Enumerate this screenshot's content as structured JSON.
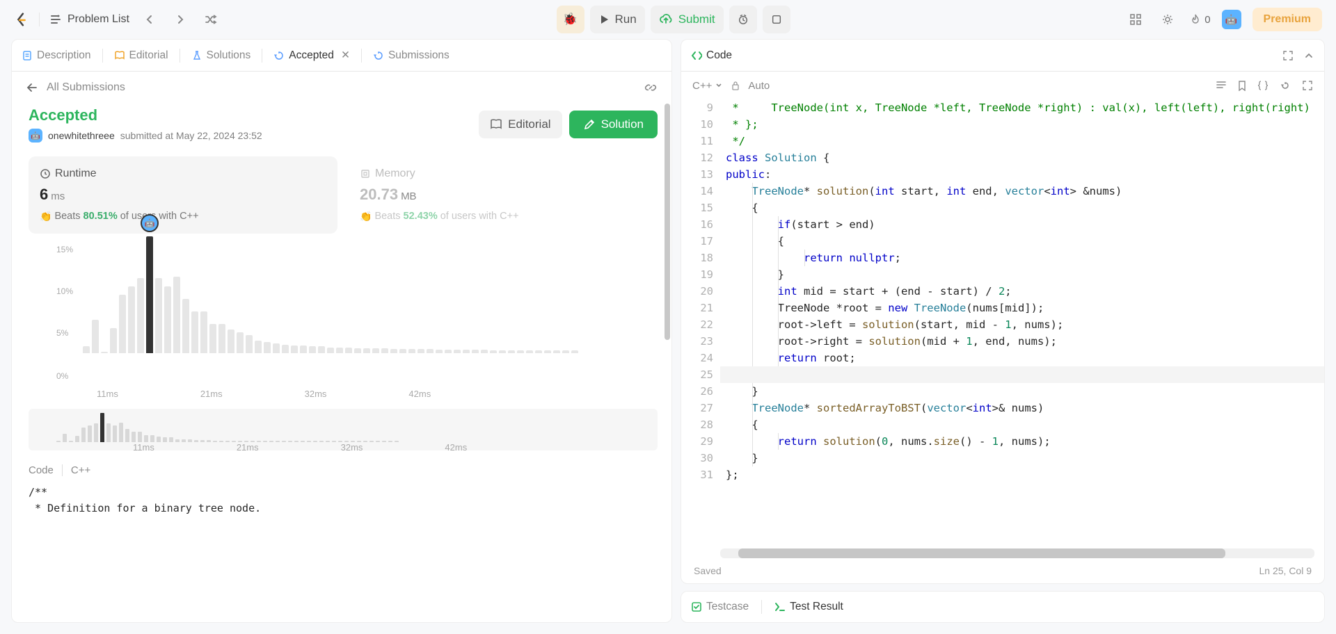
{
  "topbar": {
    "problem_list": "Problem List",
    "run": "Run",
    "submit": "Submit",
    "flame_count": "0",
    "premium": "Premium"
  },
  "tabs": {
    "description": "Description",
    "editorial": "Editorial",
    "solutions": "Solutions",
    "accepted": "Accepted",
    "submissions": "Submissions",
    "code": "Code"
  },
  "subheader": {
    "all_submissions": "All Submissions"
  },
  "result": {
    "status": "Accepted",
    "username": "onewhitethreee",
    "submitted_at": "submitted at May 22, 2024 23:52",
    "btn_editorial": "Editorial",
    "btn_solution": "Solution"
  },
  "stats": {
    "runtime": {
      "label": "Runtime",
      "value": "6",
      "unit": "ms",
      "beats_label": "Beats",
      "beats_pct": "80.51%",
      "beats_rest": "of users with C++"
    },
    "memory": {
      "label": "Memory",
      "value": "20.73",
      "unit": "MB",
      "beats_label": "Beats",
      "beats_pct": "52.43%",
      "beats_rest": "of users with C++"
    }
  },
  "chart_data": {
    "type": "bar",
    "ylabel": "percent",
    "yticks": [
      "15%",
      "10%",
      "5%",
      "0%"
    ],
    "xticks": [
      "11ms",
      "21ms",
      "32ms",
      "42ms"
    ],
    "bars_pct": [
      0.8,
      4,
      0.2,
      3,
      7,
      8,
      9,
      14,
      9,
      8,
      9.2,
      6.5,
      5,
      5,
      3.5,
      3.5,
      2.8,
      2.5,
      2.2,
      1.5,
      1.3,
      1.2,
      1.0,
      0.9,
      0.9,
      0.8,
      0.8,
      0.7,
      0.7,
      0.7,
      0.6,
      0.6,
      0.6,
      0.6,
      0.5,
      0.5,
      0.5,
      0.5,
      0.5,
      0.4,
      0.4,
      0.4,
      0.4,
      0.4,
      0.4,
      0.3,
      0.3,
      0.3,
      0.3,
      0.3,
      0.3,
      0.3,
      0.3,
      0.3,
      0.3
    ],
    "highlight_index": 7,
    "mini_xticks": [
      "11ms",
      "21ms",
      "32ms",
      "42ms"
    ]
  },
  "code_section": {
    "label": "Code",
    "lang": "C++",
    "snippet_lines": [
      "/**",
      " * Definition for a binary tree node."
    ]
  },
  "editor": {
    "lang": "C++",
    "auto": "Auto",
    "saved": "Saved",
    "cursor": "Ln 25, Col 9",
    "start_line": 9,
    "lines": [
      [
        {
          "t": " *     ",
          "c": "com"
        },
        {
          "t": "TreeNode(int x, TreeNode *left, TreeNode *right) : val(x), left(left), right(right)",
          "c": "com"
        }
      ],
      [
        {
          "t": " * };",
          "c": "com"
        }
      ],
      [
        {
          "t": " */",
          "c": "com"
        }
      ],
      [
        {
          "t": "class ",
          "c": "kw"
        },
        {
          "t": "Solution",
          "c": "cls"
        },
        {
          "t": " {",
          "c": ""
        }
      ],
      [
        {
          "t": "public",
          "c": "kw"
        },
        {
          "t": ":",
          "c": ""
        }
      ],
      [
        {
          "t": "    ",
          "c": ""
        },
        {
          "t": "TreeNode",
          "c": "type2"
        },
        {
          "t": "* ",
          "c": ""
        },
        {
          "t": "solution",
          "c": "fn"
        },
        {
          "t": "(",
          "c": ""
        },
        {
          "t": "int",
          "c": "kw"
        },
        {
          "t": " start, ",
          "c": ""
        },
        {
          "t": "int",
          "c": "kw"
        },
        {
          "t": " end, ",
          "c": ""
        },
        {
          "t": "vector",
          "c": "type2"
        },
        {
          "t": "<",
          "c": ""
        },
        {
          "t": "int",
          "c": "kw"
        },
        {
          "t": "> &nums)",
          "c": ""
        }
      ],
      [
        {
          "t": "    {",
          "c": ""
        }
      ],
      [
        {
          "t": "        ",
          "c": ""
        },
        {
          "t": "if",
          "c": "kw"
        },
        {
          "t": "(start > end)",
          "c": ""
        }
      ],
      [
        {
          "t": "        {",
          "c": ""
        }
      ],
      [
        {
          "t": "            ",
          "c": ""
        },
        {
          "t": "return",
          "c": "kw"
        },
        {
          "t": " ",
          "c": ""
        },
        {
          "t": "nullptr",
          "c": "kw"
        },
        {
          "t": ";",
          "c": ""
        }
      ],
      [
        {
          "t": "        }",
          "c": ""
        }
      ],
      [
        {
          "t": "        ",
          "c": ""
        },
        {
          "t": "int",
          "c": "kw"
        },
        {
          "t": " mid = start + (end - start) / ",
          "c": ""
        },
        {
          "t": "2",
          "c": "num"
        },
        {
          "t": ";",
          "c": ""
        }
      ],
      [
        {
          "t": "        TreeNode *root = ",
          "c": ""
        },
        {
          "t": "new",
          "c": "kw"
        },
        {
          "t": " ",
          "c": ""
        },
        {
          "t": "TreeNode",
          "c": "type2"
        },
        {
          "t": "(nums[mid]);",
          "c": ""
        }
      ],
      [
        {
          "t": "        root->left = ",
          "c": ""
        },
        {
          "t": "solution",
          "c": "fn"
        },
        {
          "t": "(start, mid - ",
          "c": ""
        },
        {
          "t": "1",
          "c": "num"
        },
        {
          "t": ", nums);",
          "c": ""
        }
      ],
      [
        {
          "t": "        root->right = ",
          "c": ""
        },
        {
          "t": "solution",
          "c": "fn"
        },
        {
          "t": "(mid + ",
          "c": ""
        },
        {
          "t": "1",
          "c": "num"
        },
        {
          "t": ", end, nums);",
          "c": ""
        }
      ],
      [
        {
          "t": "        ",
          "c": ""
        },
        {
          "t": "return",
          "c": "kw"
        },
        {
          "t": " root;",
          "c": ""
        }
      ],
      [
        {
          "t": "",
          "c": ""
        }
      ],
      [
        {
          "t": "    }",
          "c": ""
        }
      ],
      [
        {
          "t": "    ",
          "c": ""
        },
        {
          "t": "TreeNode",
          "c": "type2"
        },
        {
          "t": "* ",
          "c": ""
        },
        {
          "t": "sortedArrayToBST",
          "c": "fn"
        },
        {
          "t": "(",
          "c": ""
        },
        {
          "t": "vector",
          "c": "type2"
        },
        {
          "t": "<",
          "c": ""
        },
        {
          "t": "int",
          "c": "kw"
        },
        {
          "t": ">& nums)",
          "c": ""
        }
      ],
      [
        {
          "t": "    {",
          "c": ""
        }
      ],
      [
        {
          "t": "        ",
          "c": ""
        },
        {
          "t": "return",
          "c": "kw"
        },
        {
          "t": " ",
          "c": ""
        },
        {
          "t": "solution",
          "c": "fn"
        },
        {
          "t": "(",
          "c": ""
        },
        {
          "t": "0",
          "c": "num"
        },
        {
          "t": ", nums.",
          "c": ""
        },
        {
          "t": "size",
          "c": "fn"
        },
        {
          "t": "() - ",
          "c": ""
        },
        {
          "t": "1",
          "c": "num"
        },
        {
          "t": ", nums);",
          "c": ""
        }
      ],
      [
        {
          "t": "    }",
          "c": ""
        }
      ],
      [
        {
          "t": "};",
          "c": ""
        }
      ]
    ]
  },
  "bottom": {
    "testcase": "Testcase",
    "test_result": "Test Result"
  }
}
